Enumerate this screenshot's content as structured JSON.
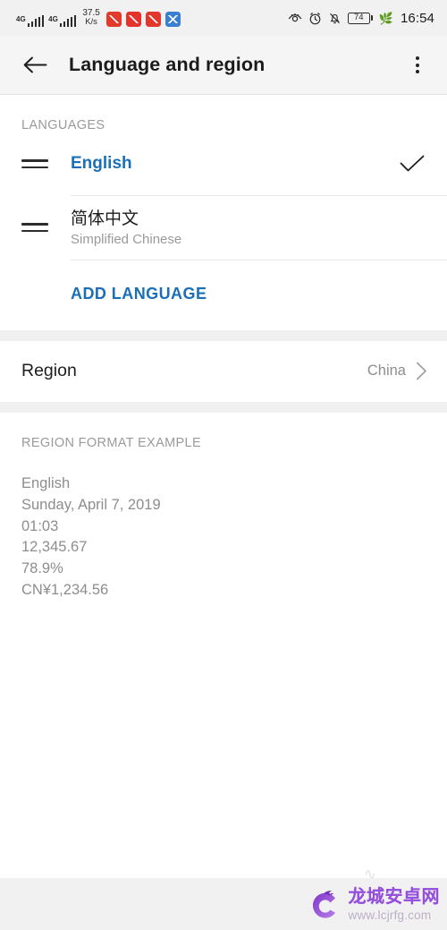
{
  "status_bar": {
    "sim1_network": "4G",
    "sim2_network": "4G",
    "net_speed_value": "37.5",
    "net_speed_unit": "K/s",
    "notification_icons": [
      "app-notification-icon-1",
      "app-notification-icon-2",
      "app-notification-icon-3",
      "app-notification-icon-4"
    ],
    "eye_comfort_icon": "eye-comfort-icon",
    "alarm_icon": "alarm-clock-icon",
    "silent_icon": "bell-off-icon",
    "battery_percent": "74",
    "power_saving_icon": "leaf-icon",
    "time": "16:54"
  },
  "app_bar": {
    "back_icon": "back-arrow-icon",
    "title": "Language and region",
    "overflow_icon": "overflow-menu-icon"
  },
  "languages_section": {
    "header": "LANGUAGES",
    "items": [
      {
        "name": "English",
        "subtitle": "",
        "selected": true,
        "drag_icon": "drag-handle-icon",
        "check_icon": "check-icon"
      },
      {
        "name": "简体中文",
        "subtitle": "Simplified Chinese",
        "selected": false,
        "drag_icon": "drag-handle-icon",
        "check_icon": ""
      }
    ],
    "add_language_label": "ADD LANGUAGE"
  },
  "region_section": {
    "label": "Region",
    "value": "China",
    "chevron_icon": "chevron-right-icon"
  },
  "region_format_section": {
    "header": "REGION FORMAT EXAMPLE",
    "lines": [
      "English",
      "Sunday, April 7, 2019",
      "01:03",
      "12,345.67",
      "78.9%",
      "CN¥1,234.56"
    ]
  },
  "watermark": {
    "site_name": "龙城安卓网",
    "site_url": "www.lcjrfg.com",
    "logo_icon": "dragon-logo-icon"
  },
  "colors": {
    "accent_blue": "#1b6fb8",
    "page_bg": "#f0f0f0",
    "card_bg": "#ffffff",
    "muted_text": "#9a9a9a",
    "watermark_purple": "#9149dd"
  }
}
